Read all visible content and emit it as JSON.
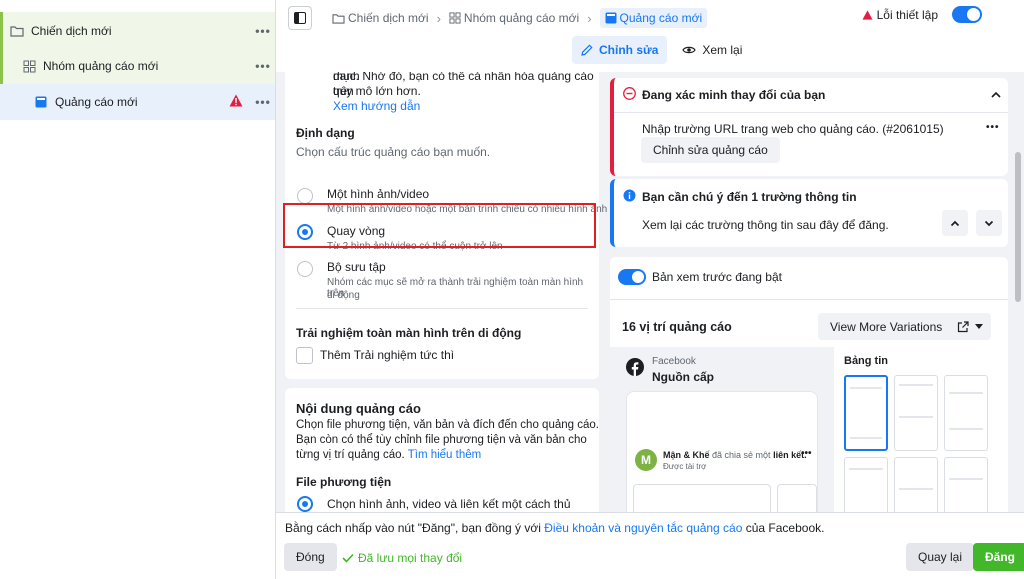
{
  "sidebar": {
    "items": [
      {
        "label": "Chiến dịch mới",
        "icon": "folder-icon",
        "more": "•••"
      },
      {
        "label": "Nhóm quảng cáo mới",
        "icon": "grid-icon",
        "more": "•••"
      },
      {
        "label": "Quảng cáo mới",
        "icon": "ad-icon",
        "more": "•••",
        "warning": true
      }
    ]
  },
  "topbar": {
    "breadcrumbs": [
      "Chiến dịch mới",
      "Nhóm quảng cáo mới",
      "Quảng cáo mới"
    ],
    "error_label": "Lỗi thiết lập",
    "tabs": [
      "Chỉnh sửa",
      "Xem lại"
    ]
  },
  "format_section": {
    "intro_line1": "cầu quảng cáo cho từng người khi bạn đăng danh",
    "intro_line2": "mục. Nhờ đó, bạn có thể cá nhân hóa quảng cáo trên",
    "intro_line3": "quy mô lớn hơn.",
    "guide_link": "Xem hướng dẫn",
    "title": "Định dạng",
    "subtitle": "Chọn cấu trúc quảng cáo bạn muốn.",
    "options": [
      {
        "label": "Một hình ảnh/video",
        "desc": "Một hình ảnh/video hoặc một bản trình chiếu có nhiều hình ảnh",
        "selected": false
      },
      {
        "label": "Quay vòng",
        "desc": "Từ 2 hình ảnh/video có thể cuộn trở lên",
        "selected": true
      },
      {
        "label": "Bộ sưu tập",
        "desc_line1": "Nhóm các mục sẽ mở ra thành trải nghiệm toàn màn hình trên",
        "desc_line2": "di động",
        "selected": false
      }
    ],
    "fullscreen_title": "Trải nghiệm toàn màn hình trên di động",
    "instant_checkbox": "Thêm Trải nghiệm tức thì"
  },
  "content_section": {
    "title": "Nội dung quảng cáo",
    "line1": "Chọn file phương tiện, văn bản và đích đến cho quảng cáo.",
    "line2": "Bạn còn có thể tùy chỉnh file phương tiện và văn bản cho",
    "line3": "từng vị trí quảng cáo.",
    "learn_link": "Tìm hiểu thêm",
    "media_title": "File phương tiện",
    "media_option": "Chọn hình ảnh, video và liên kết một cách thủ công"
  },
  "error_card": {
    "title": "Đang xác minh thay đổi của bạn",
    "message": "Nhập trường URL trang web cho quảng cáo. (#2061015)",
    "more": "•••",
    "button": "Chỉnh sửa quảng cáo"
  },
  "info_card": {
    "title": "Bạn cần chú ý đến 1 trường thông tin",
    "message": "Xem lại các trường thông tin sau đây để đăng."
  },
  "preview": {
    "toggle_label": "Bản xem trước đang bật",
    "placements": "16 vị trí quảng cáo",
    "variations_button": "View More Variations",
    "platform": "Facebook",
    "feed_label": "Nguồn cấp",
    "feed_heading": "Bảng tin",
    "post_author": "Mận & Khế",
    "post_action": "đã chia sẻ một",
    "post_link": "liên kết.",
    "post_sponsored": "Được tài trợ",
    "avatar_letter": "M"
  },
  "footer": {
    "text_before": "Bằng cách nhấp vào nút \"Đăng\", bạn đồng ý với",
    "terms_link": "Điều khoản và nguyên tắc quảng cáo",
    "text_after": "của Facebook.",
    "close_button": "Đóng",
    "saved_label": "Đã lưu mọi thay đổi",
    "back_button": "Quay lại",
    "publish_button": "Đăng"
  },
  "colors": {
    "accent": "#1877f2",
    "error": "#e41e3f",
    "success": "#42b72a",
    "highlight": "#e02020"
  }
}
